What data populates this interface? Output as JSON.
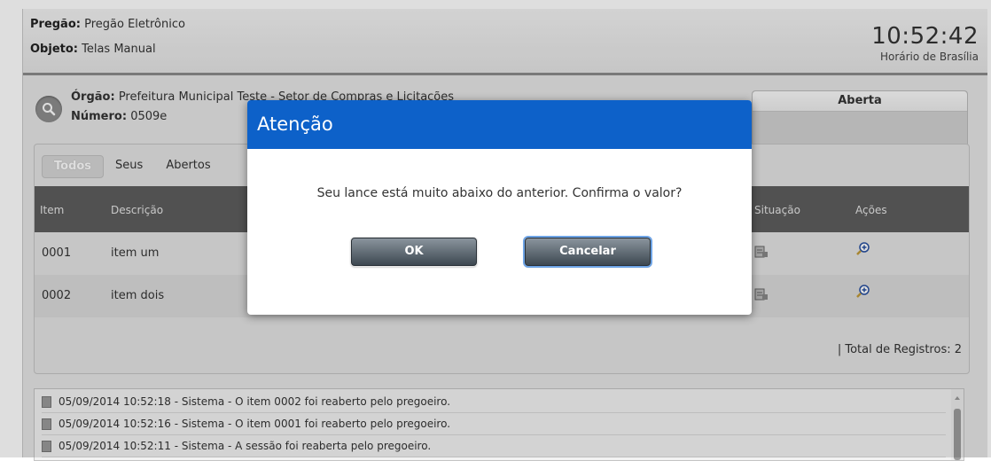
{
  "header": {
    "pregao_label": "Pregão:",
    "pregao_value": "Pregão Eletrônico",
    "objeto_label": "Objeto:",
    "objeto_value": "Telas Manual",
    "clock": "10:52:42",
    "timezone": "Horário de Brasília"
  },
  "info": {
    "orgao_label": "Órgão:",
    "orgao_value": "Prefeitura Municipal Teste - Setor de Compras e Licitações",
    "numero_label": "Número:",
    "numero_value": "0509e"
  },
  "status": {
    "label": "Aberta"
  },
  "tabs": [
    {
      "label": "Todos"
    },
    {
      "label": "Seus"
    },
    {
      "label": "Abertos"
    }
  ],
  "table": {
    "headers": {
      "item": "Item",
      "descricao": "Descrição",
      "situacao": "Situação",
      "acoes": "Ações"
    },
    "rows": [
      {
        "item": "0001",
        "descricao": "item um"
      },
      {
        "item": "0002",
        "descricao": "item dois"
      }
    ],
    "total": "| Total de Registros: 2"
  },
  "log": [
    "05/09/2014 10:52:18 - Sistema - O item 0002 foi reaberto pelo pregoeiro.",
    "05/09/2014 10:52:16 - Sistema - O item 0001 foi reaberto pelo pregoeiro.",
    "05/09/2014 10:52:11 - Sistema - A sessão foi reaberta pelo pregoeiro."
  ],
  "modal": {
    "title": "Atenção",
    "message": "Seu lance está muito abaixo do anterior. Confirma o valor?",
    "ok_label": "OK",
    "cancel_label": "Cancelar"
  },
  "colors": {
    "modal_header": "#0d61c9",
    "table_header": "#5d5d5d"
  }
}
